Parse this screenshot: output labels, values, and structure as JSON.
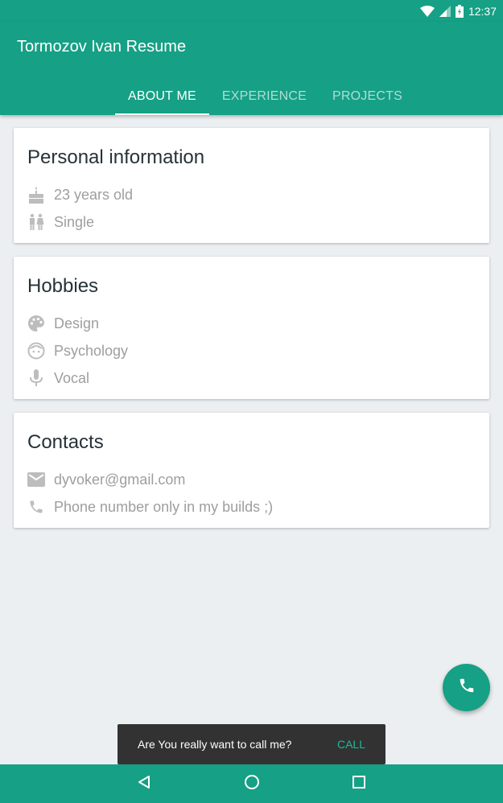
{
  "status_bar": {
    "time": "12:37"
  },
  "app_bar": {
    "title": "Tormozov Ivan Resume"
  },
  "tabs": [
    {
      "label": "ABOUT ME",
      "active": true
    },
    {
      "label": "EXPERIENCE",
      "active": false
    },
    {
      "label": "PROJECTS",
      "active": false
    }
  ],
  "personal": {
    "title": "Personal information",
    "items": [
      {
        "icon": "cake-icon",
        "text": "23 years old"
      },
      {
        "icon": "wc-icon",
        "text": "Single"
      }
    ]
  },
  "hobbies": {
    "title": "Hobbies",
    "items": [
      {
        "icon": "palette-icon",
        "text": "Design"
      },
      {
        "icon": "face-icon",
        "text": "Psychology"
      },
      {
        "icon": "mic-icon",
        "text": "Vocal"
      }
    ]
  },
  "contacts": {
    "title": "Contacts",
    "items": [
      {
        "icon": "email-icon",
        "text": "dyvoker@gmail.com"
      },
      {
        "icon": "phone-icon",
        "text": "Phone number only in my builds ;)"
      }
    ]
  },
  "fab": {
    "icon": "phone-icon"
  },
  "snackbar": {
    "message": "Are You really want to call me?",
    "action": "CALL"
  },
  "colors": {
    "primary": "#16a085",
    "accent": "#1abc9c",
    "background": "#eceff1",
    "secondary_text": "#9e9e9e"
  }
}
